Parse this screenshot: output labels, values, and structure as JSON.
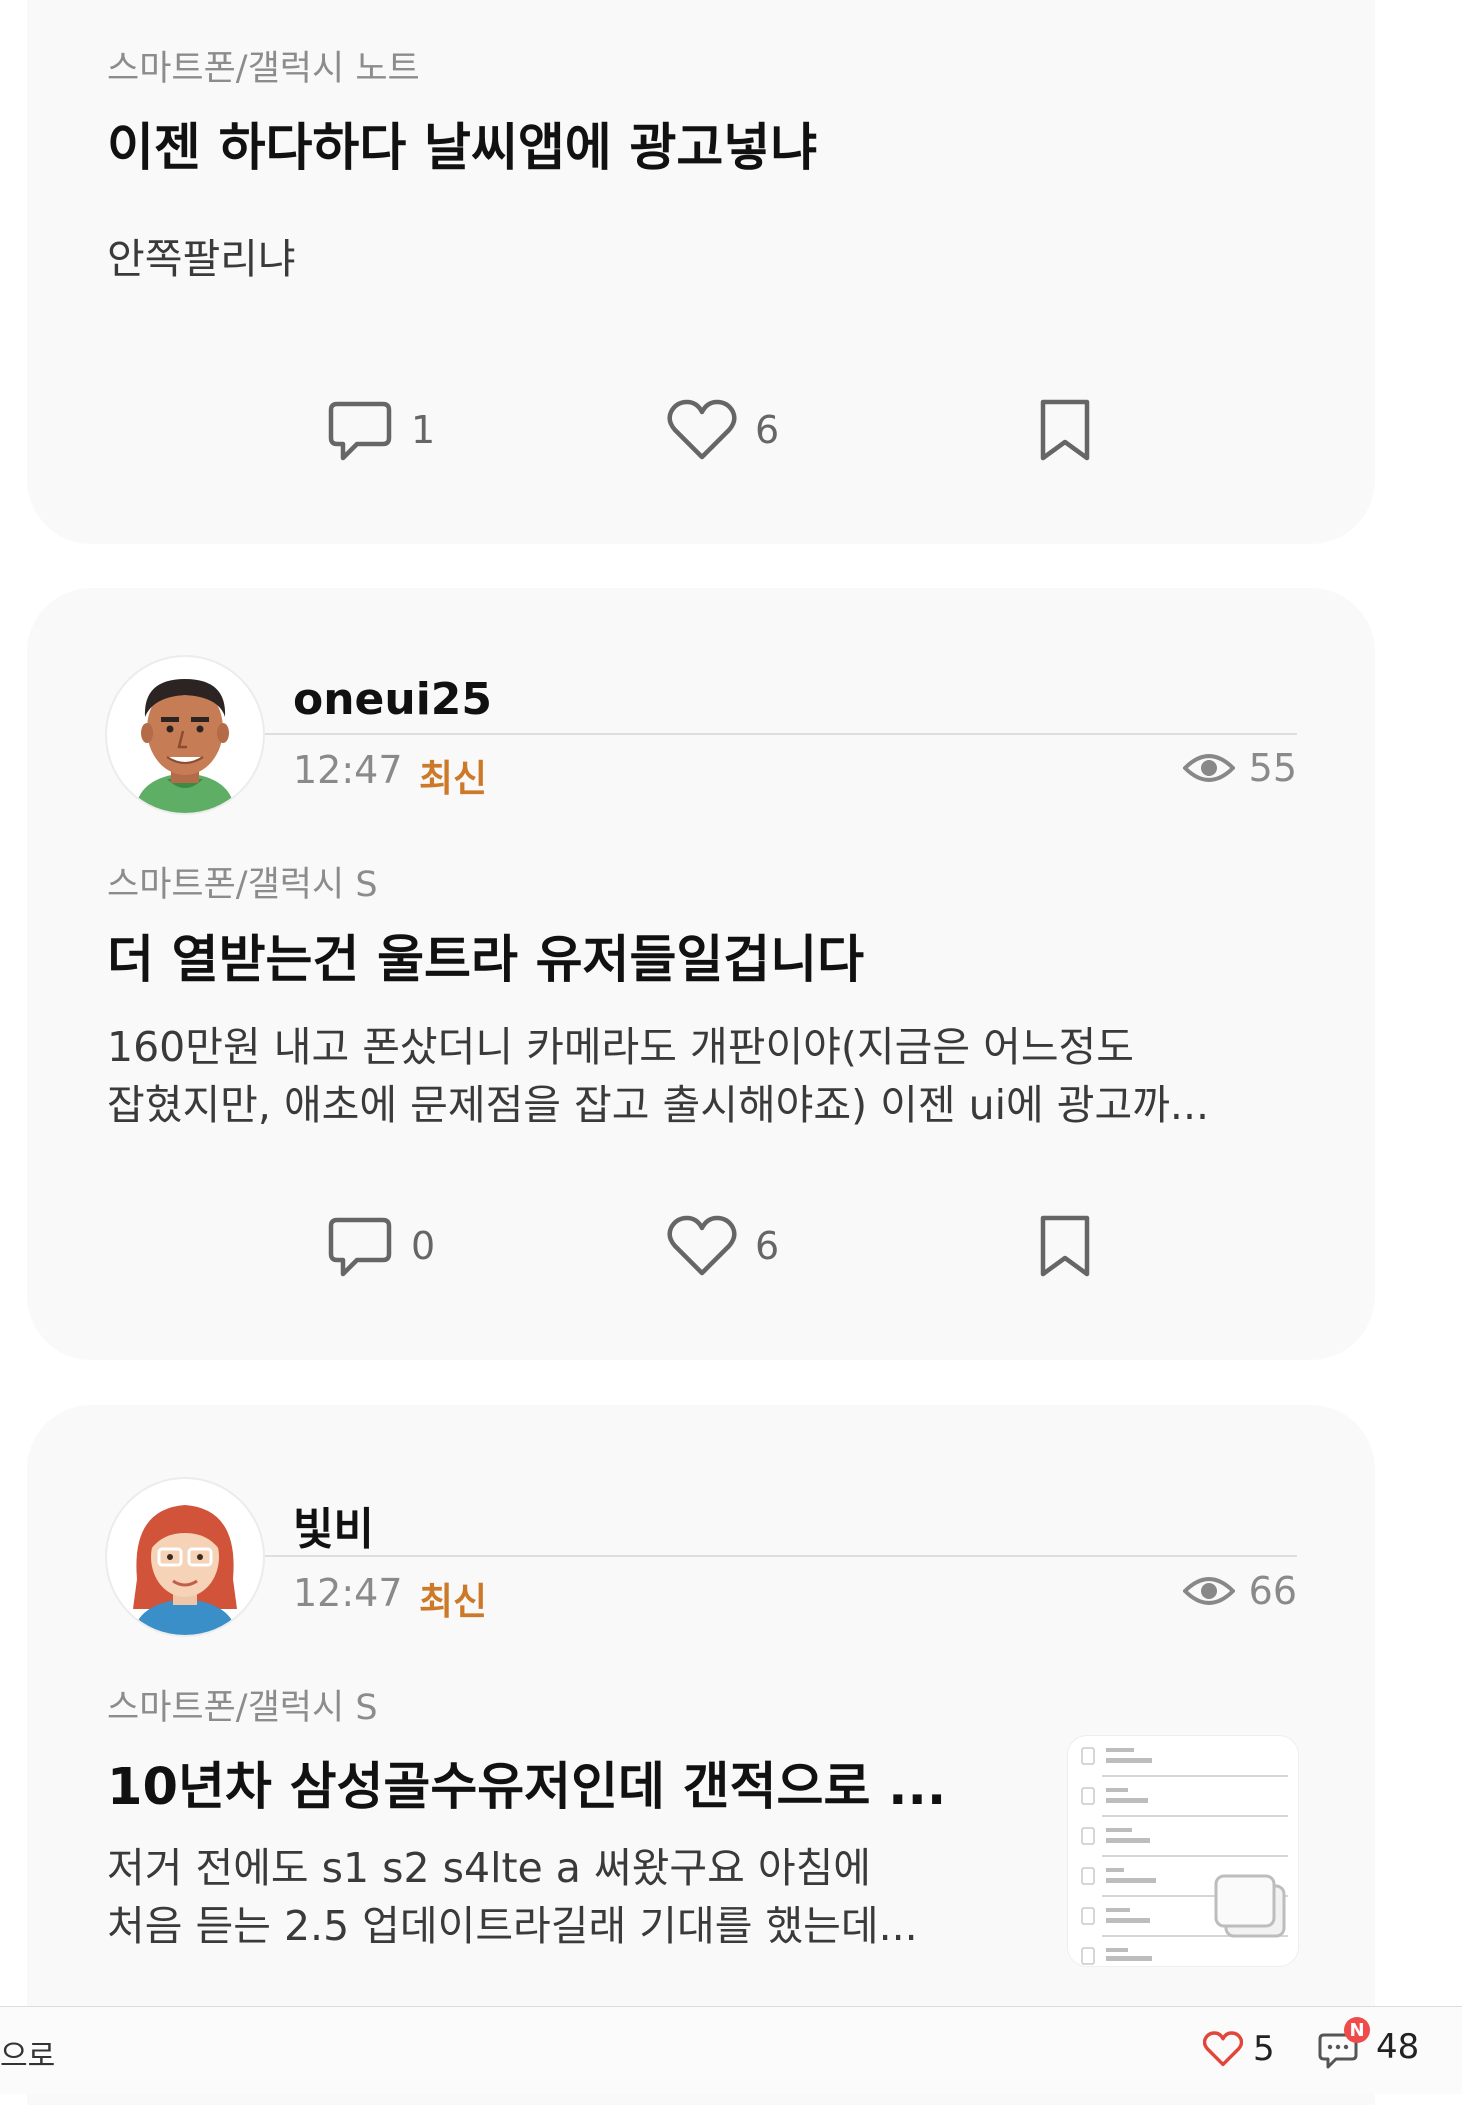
{
  "posts": [
    {
      "category": "스마트폰/갤럭시 노트",
      "title": "이젠 하다하다 날씨앱에 광고넣냐",
      "body": "안쪽팔리냐",
      "comments": "1",
      "likes": "6"
    },
    {
      "author": "oneui25",
      "time": "12:47",
      "badge": "최신",
      "views": "55",
      "category": "스마트폰/갤럭시 S",
      "title": "더 열받는건 울트라 유저들일겁니다",
      "body_line1": "160만원 내고 폰샀더니 카메라도 개판이야(지금은 어느정도",
      "body_line2": "잡혔지만, 애초에 문제점을 잡고 출시해야죠) 이젠 ui에 광고까...",
      "comments": "0",
      "likes": "6"
    },
    {
      "author": "빛비",
      "time": "12:47",
      "badge": "최신",
      "views": "66",
      "category": "스마트폰/갤럭시 S",
      "title": "10년차 삼성골수유저인데 갠적으로 ...",
      "body_line1": "저거 전에도 s1 s2 s4lte a 써왔구요 아침에",
      "body_line2": "처음 듣는 2.5 업데이트라길래 기대를 했는데..."
    }
  ],
  "bottom_bar": {
    "left_text": "으로",
    "likes": "5",
    "comments": "48",
    "new_badge": "N"
  },
  "colors": {
    "badge": "#cc7a2a",
    "card_bg": "#f9f9f9",
    "notification": "#ef4b4b"
  },
  "icons": [
    "comment-icon",
    "heart-icon",
    "bookmark-icon",
    "eye-icon",
    "image-stack-icon"
  ]
}
